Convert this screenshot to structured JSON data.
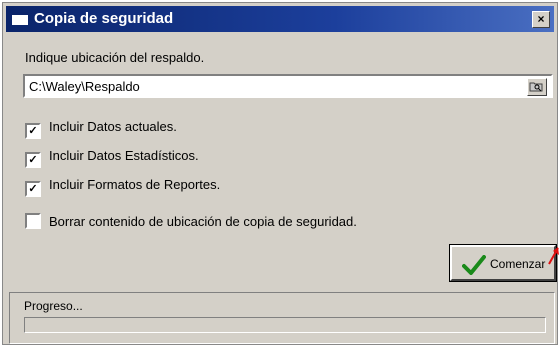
{
  "window": {
    "title": "Copia de seguridad",
    "close_glyph": "×"
  },
  "form": {
    "location_label": "Indique ubicación del respaldo.",
    "path_value": "C:\\Waley\\Respaldo"
  },
  "options": [
    {
      "label": "Incluir Datos actuales.",
      "checked": true
    },
    {
      "label": "Incluir Datos Estadísticos.",
      "checked": true
    },
    {
      "label": "Incluir Formatos de Reportes.",
      "checked": true
    },
    {
      "label": "Borrar contenido de ubicación de copia de seguridad.",
      "checked": false
    }
  ],
  "actions": {
    "start_label": "Comenzar"
  },
  "progress": {
    "label": "Progreso...",
    "value": 0
  },
  "colors": {
    "titlebar": "#0a246a",
    "face": "#d4d0c8",
    "check_green": "#1a8a1a",
    "arrow": "#e01010"
  },
  "icons": [
    "window-icon",
    "close-icon",
    "folder-browse-icon",
    "checkmark-icon",
    "red-arrow-icon"
  ]
}
